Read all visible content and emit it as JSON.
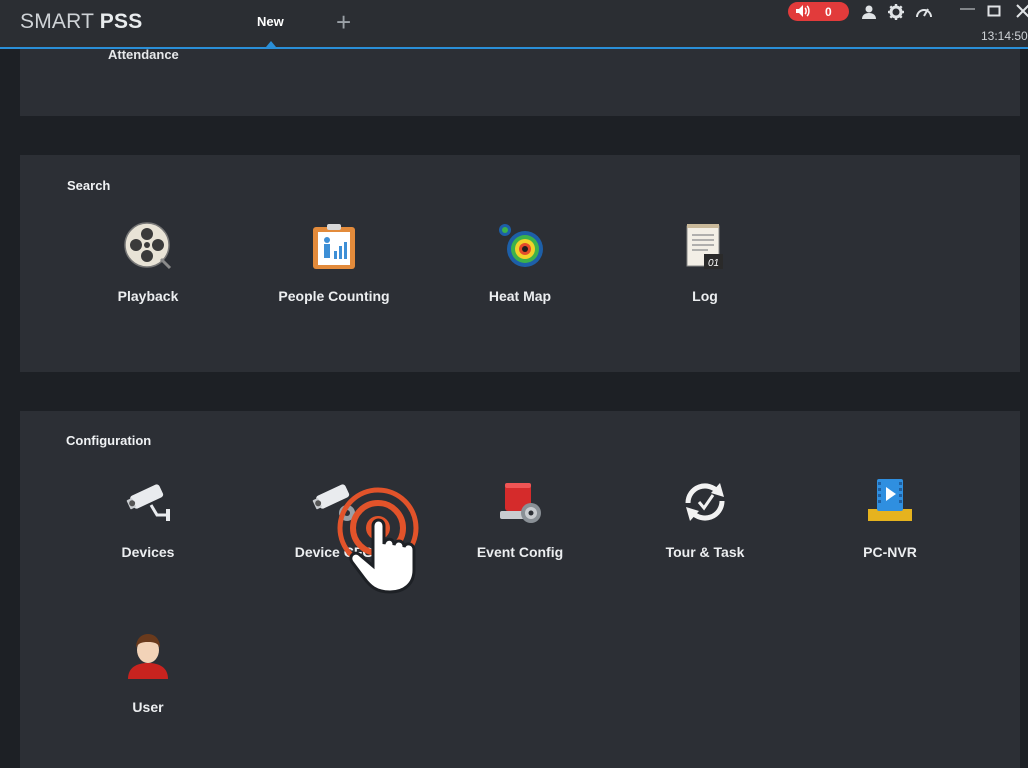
{
  "app": {
    "brand_regular": "SMART ",
    "brand_bold": "PSS",
    "tab_label": "New",
    "add_tab_glyph": "+",
    "alarm_count": "0",
    "clock": "13:14:50",
    "accent_color": "#2a8fd8",
    "alarm_color": "#e23b3b"
  },
  "top_section": {
    "item_label": "Attendance"
  },
  "search_section": {
    "title": "Search",
    "items": [
      {
        "label": "Playback",
        "icon": "film-reel-icon"
      },
      {
        "label": "People Counting",
        "icon": "people-counting-icon"
      },
      {
        "label": "Heat Map",
        "icon": "heat-map-icon"
      },
      {
        "label": "Log",
        "icon": "log-icon"
      }
    ]
  },
  "config_section": {
    "title": "Configuration",
    "items": [
      {
        "label": "Devices",
        "icon": "camera-icon"
      },
      {
        "label": "Device CFG",
        "icon": "device-cfg-icon"
      },
      {
        "label": "Event Config",
        "icon": "siren-icon"
      },
      {
        "label": "Tour & Task",
        "icon": "tour-task-icon"
      },
      {
        "label": "PC-NVR",
        "icon": "pc-nvr-icon"
      },
      {
        "label": "User",
        "icon": "user-icon"
      }
    ]
  }
}
